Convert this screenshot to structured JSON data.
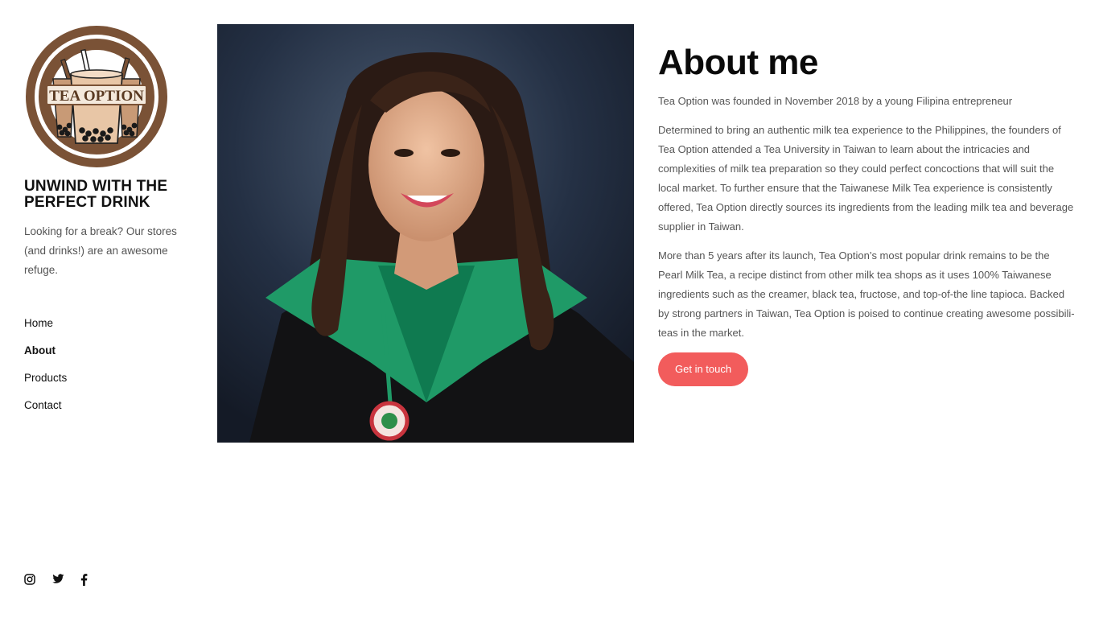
{
  "brand": {
    "logo_text": "TEA OPTION",
    "tagline": "UNWIND WITH THE PERFECT DRINK",
    "blurb": "Looking for a break? Our stores (and drinks!) are an awesome refuge."
  },
  "nav": {
    "items": [
      {
        "label": "Home"
      },
      {
        "label": "About"
      },
      {
        "label": "Products"
      },
      {
        "label": "Contact"
      }
    ]
  },
  "social": {
    "icons": [
      "instagram-icon",
      "twitter-icon",
      "facebook-icon"
    ]
  },
  "main": {
    "title": "About me",
    "paragraphs": [
      "Tea Option was founded in November 2018 by a young Filipina entrepreneur",
      "Determined to bring an authentic milk tea experience to the Philippines, the founders of Tea Option attended a Tea University in Taiwan to learn about the intricacies and complexities of milk tea preparation so they could perfect concoctions that will suit the local market. To further ensure that the Taiwanese Milk Tea experience is consistently offered, Tea Option directly sources its ingredients from the leading milk tea and beverage supplier in Taiwan.",
      "More than 5 years after its launch, Tea Option’s most popular drink remains to be the Pearl Milk Tea, a recipe distinct from other milk tea shops as it uses 100% Taiwanese ingredients such as the creamer, black tea, fructose, and top-of-the line tapioca. Backed by strong partners in Taiwan, Tea Option is poised to continue creating awesome possibili-teas in the market."
    ],
    "cta_label": "Get in touch"
  },
  "colors": {
    "accent": "#f25c5c",
    "logo_brown": "#7a5236",
    "text_muted": "#555555"
  }
}
